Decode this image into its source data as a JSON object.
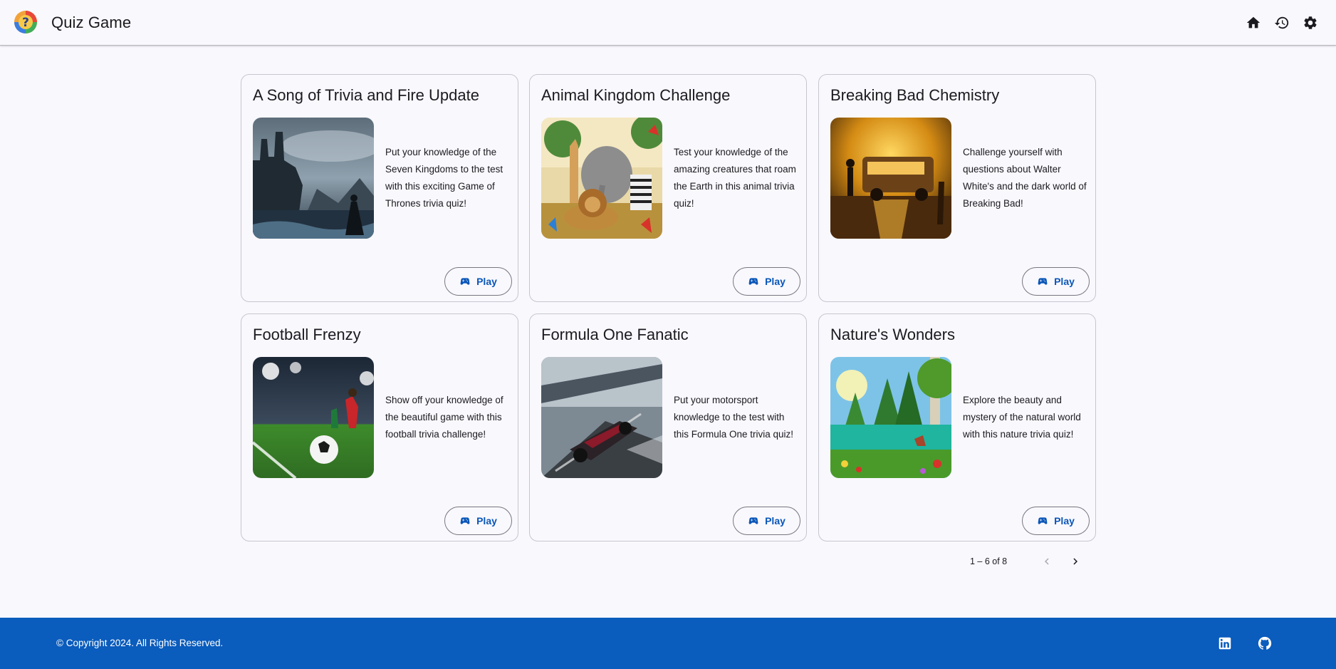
{
  "header": {
    "title": "Quiz Game",
    "icons": [
      "home-icon",
      "history-icon",
      "settings-icon"
    ]
  },
  "quizzes": [
    {
      "title": "A Song of Trivia and Fire Update",
      "description": "Put your knowledge of the Seven Kingdoms to the test with this exciting Game of Thrones trivia quiz!",
      "play_label": "Play"
    },
    {
      "title": "Animal Kingdom Challenge",
      "description": "Test your knowledge of the amazing creatures that roam the Earth in this animal trivia quiz!",
      "play_label": "Play"
    },
    {
      "title": "Breaking Bad Chemistry",
      "description": "Challenge yourself with questions about Walter White's and the dark world of Breaking Bad!",
      "play_label": "Play"
    },
    {
      "title": "Football Frenzy",
      "description": "Show off your knowledge of the beautiful game with this football trivia challenge!",
      "play_label": "Play"
    },
    {
      "title": "Formula One Fanatic",
      "description": "Put your motorsport knowledge to the test with this Formula One trivia quiz!",
      "play_label": "Play"
    },
    {
      "title": "Nature's Wonders",
      "description": "Explore the beauty and mystery of the natural world with this nature trivia quiz!",
      "play_label": "Play"
    }
  ],
  "pagination": {
    "range_label": "1 – 6 of 8",
    "prev_enabled": false,
    "next_enabled": true
  },
  "footer": {
    "copyright": "© Copyright 2024. All Rights Reserved.",
    "icons": [
      "linkedin-icon",
      "github-icon"
    ]
  },
  "colors": {
    "accent": "#0a56b8",
    "footer_bg": "#0a5cbd",
    "page_bg": "#f9f8fd",
    "card_border": "#c6c6d0"
  }
}
